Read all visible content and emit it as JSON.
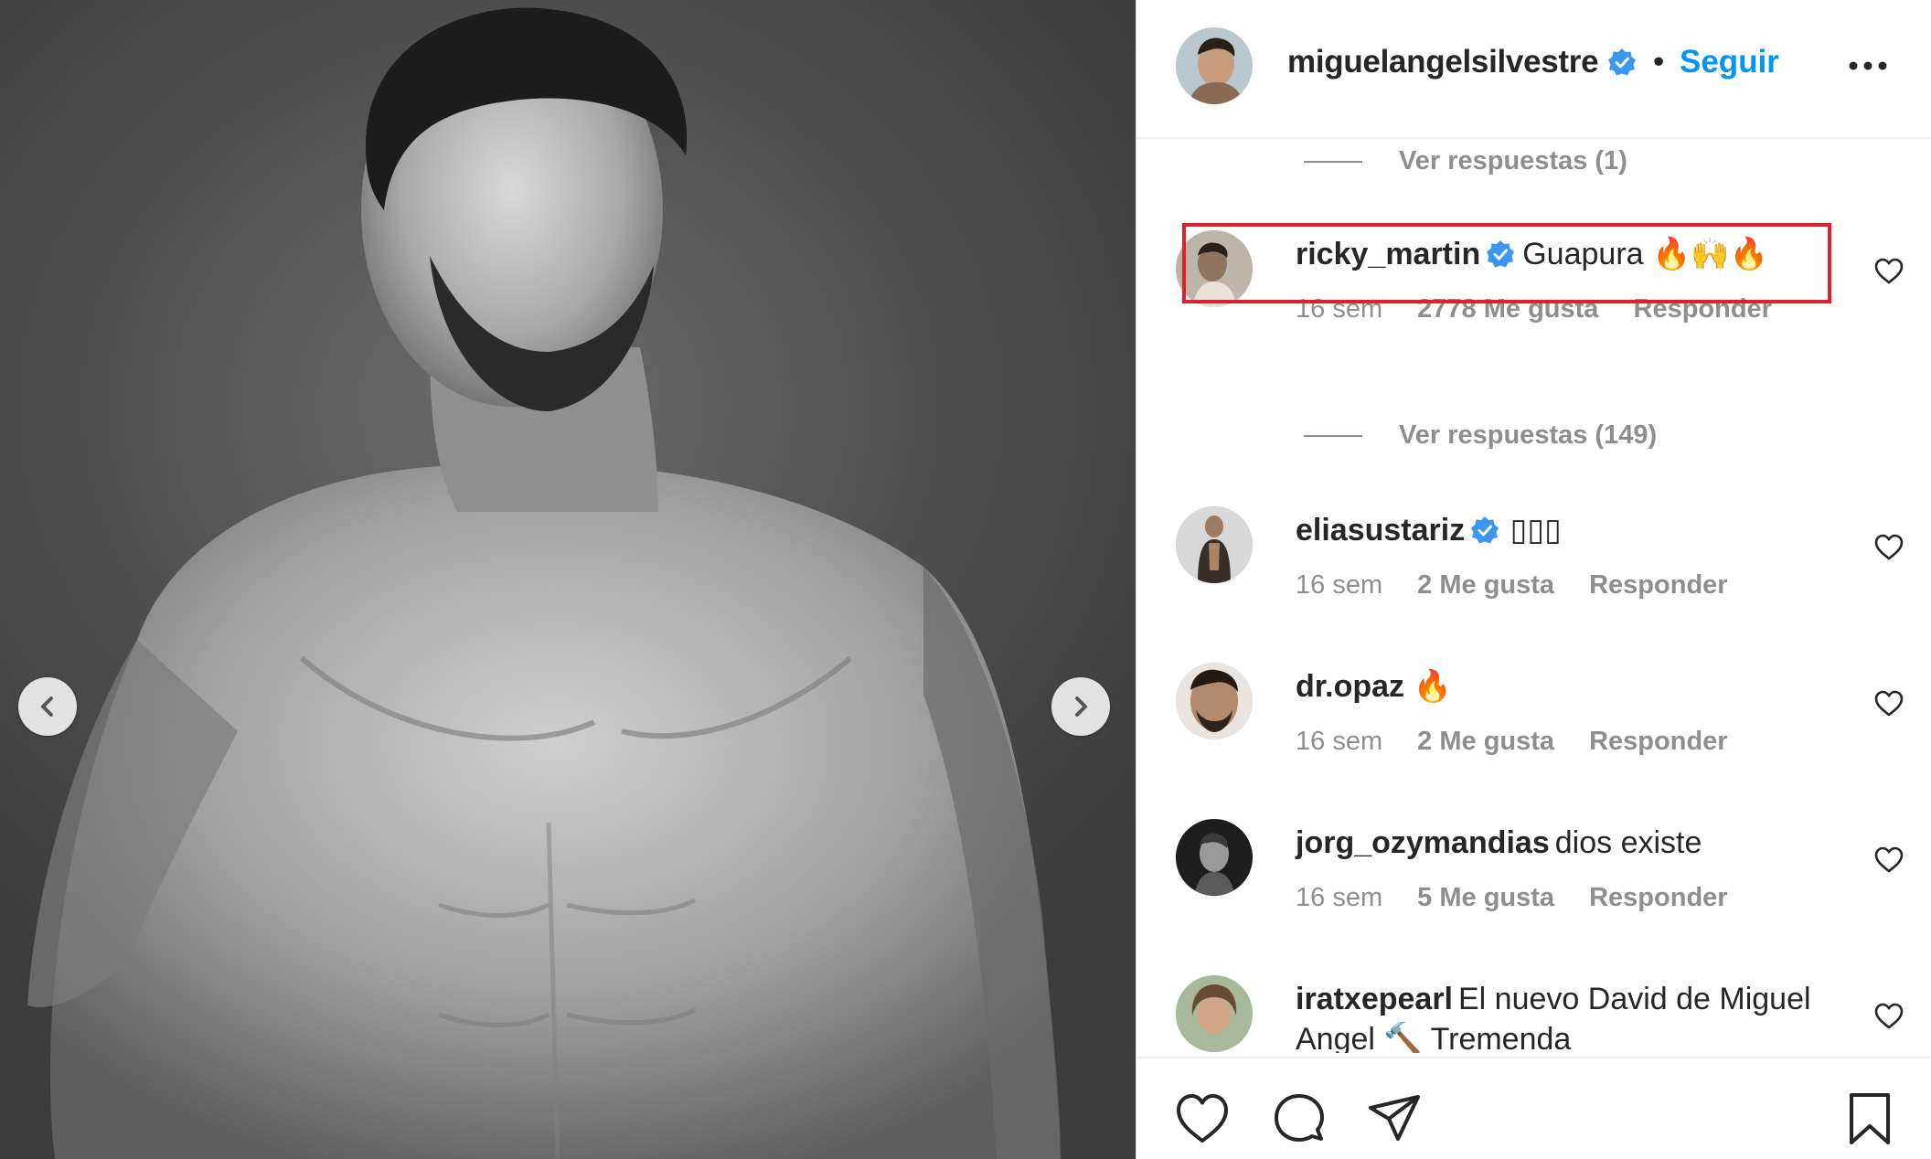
{
  "post": {
    "owner": "miguelangelsilvestre",
    "follow_label": "Seguir",
    "separator": "•"
  },
  "comments": {
    "replies_1": "Ver respuestas (1)",
    "replies_2": "Ver respuestas (149)",
    "items": [
      {
        "user": "ricky_martin",
        "verified": true,
        "text": "Guapura",
        "emoji": "🔥🙌🔥",
        "time": "16 sem",
        "likes": "2778 Me gusta",
        "reply": "Responder"
      },
      {
        "user": "eliasustariz",
        "verified": true,
        "text": "",
        "emoji": "▯▯▯",
        "time": "16 sem",
        "likes": "2 Me gusta",
        "reply": "Responder"
      },
      {
        "user": "dr.opaz",
        "verified": false,
        "text": "",
        "emoji": "🔥",
        "time": "16 sem",
        "likes": "2 Me gusta",
        "reply": "Responder"
      },
      {
        "user": "jorg_ozymandias",
        "verified": false,
        "text": "dios existe",
        "time": "16 sem",
        "likes": "5 Me gusta",
        "reply": "Responder"
      },
      {
        "user": "iratxepearl",
        "verified": false,
        "text": "El nuevo David de Miguel Angel",
        "text2": "Tremenda",
        "emoji": "🔨"
      }
    ]
  },
  "icons": {
    "prev": "chevron-left-icon",
    "next": "chevron-right-icon",
    "more": "more-options-icon",
    "like": "heart-icon",
    "comment": "comment-bubble-icon",
    "share": "paper-plane-icon",
    "save": "bookmark-icon",
    "verified": "verified-badge-icon"
  },
  "colors": {
    "accent": "#0095f6",
    "verified": "#3897f0",
    "highlight": "#e0202b",
    "muted": "#8e8e8e"
  }
}
